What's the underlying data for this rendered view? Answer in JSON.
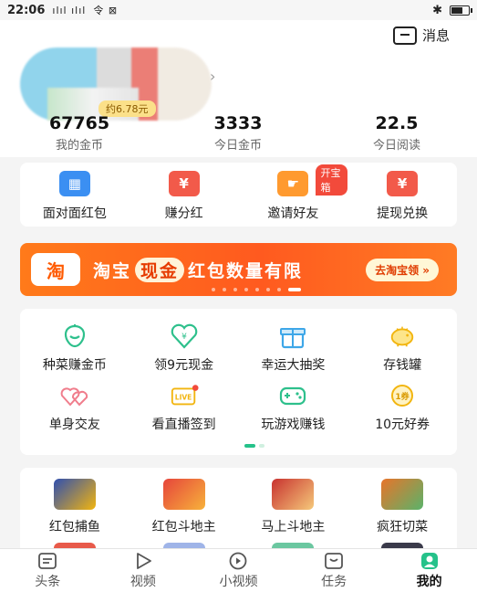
{
  "status_bar": {
    "time": "22:06",
    "signal": "ılıl ılıl",
    "net": "令 ⊠"
  },
  "header": {
    "message_label": "消息",
    "coin_tag": "约6.78元",
    "stats": [
      {
        "value": "67765",
        "label": "我的金币"
      },
      {
        "value": "3333",
        "label": "今日金币"
      },
      {
        "value": "22.5",
        "label": "今日阅读"
      }
    ]
  },
  "quick_actions": [
    {
      "label": "面对面红包",
      "icon": "qr-icon",
      "glyph": "▦",
      "color": "#3b8ff2"
    },
    {
      "label": "赚分红",
      "icon": "red-envelope-icon",
      "glyph": "¥",
      "color": "#f25a4a"
    },
    {
      "label": "邀请好友",
      "icon": "invite-hand-icon",
      "glyph": "☛",
      "color": "#ff9a2f",
      "badge": "开宝箱"
    },
    {
      "label": "提现兑换",
      "icon": "withdraw-envelope-icon",
      "glyph": "¥",
      "color": "#f25a4a"
    }
  ],
  "banner": {
    "logo": "淘",
    "text_prefix": "淘宝",
    "text_highlight": "现金",
    "text_suffix": "红包数量有限",
    "button": "去淘宝领 »"
  },
  "grid_row1": [
    {
      "label": "种菜赚金币",
      "icon": "farm-icon"
    },
    {
      "label": "领9元现金",
      "icon": "heart-cash-icon"
    },
    {
      "label": "幸运大抽奖",
      "icon": "gift-box-icon"
    },
    {
      "label": "存钱罐",
      "icon": "piggy-bank-icon"
    }
  ],
  "grid_row2": [
    {
      "label": "单身交友",
      "icon": "hearts-icon"
    },
    {
      "label": "看直播签到",
      "icon": "live-tv-icon"
    },
    {
      "label": "玩游戏赚钱",
      "icon": "gamepad-icon"
    },
    {
      "label": "10元好券",
      "icon": "coupon-icon"
    }
  ],
  "games": [
    {
      "label": "红包捕鱼",
      "icon": "fishing-game-icon",
      "color": "#2f4fb0"
    },
    {
      "label": "红包斗地主",
      "icon": "poker-game-icon",
      "color": "#e6453b"
    },
    {
      "label": "马上斗地主",
      "icon": "landlord-game-icon",
      "color": "#c8322f"
    },
    {
      "label": "疯狂切菜",
      "icon": "cutting-game-icon",
      "color": "#e8742a"
    }
  ],
  "tabs": [
    {
      "label": "头条",
      "icon": "headline-icon"
    },
    {
      "label": "视频",
      "icon": "video-icon"
    },
    {
      "label": "小视频",
      "icon": "short-video-icon"
    },
    {
      "label": "任务",
      "icon": "task-icon"
    },
    {
      "label": "我的",
      "icon": "profile-icon",
      "active": true
    }
  ]
}
